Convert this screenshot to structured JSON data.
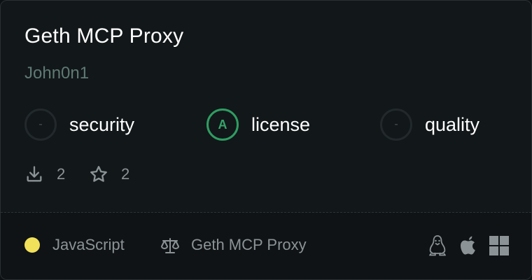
{
  "card": {
    "title": "Geth MCP Proxy",
    "author": "John0n1",
    "grades": [
      {
        "badge": "-",
        "label": "security"
      },
      {
        "badge": "A",
        "label": "license"
      },
      {
        "badge": "-",
        "label": "quality"
      }
    ],
    "stats": {
      "downloads": "2",
      "stars": "2"
    },
    "footer": {
      "language": "JavaScript",
      "language_color": "#f1e05a",
      "license": "Geth MCP Proxy",
      "platforms": [
        "linux-icon",
        "apple-icon",
        "windows-icon"
      ]
    }
  }
}
